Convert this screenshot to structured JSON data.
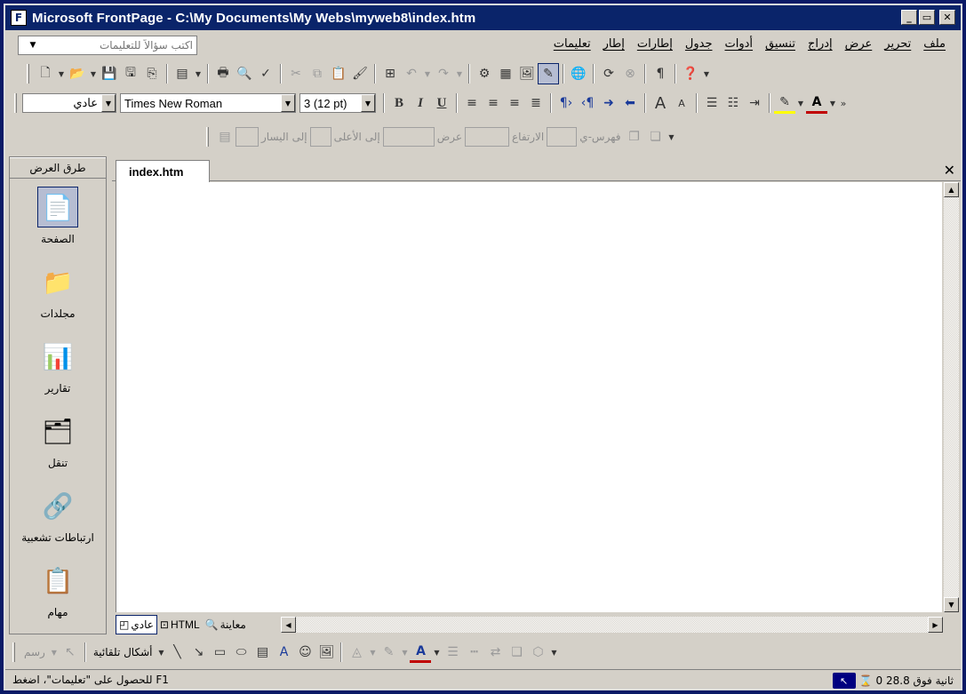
{
  "window": {
    "title": "Microsoft FrontPage - C:\\My Documents\\My Webs\\myweb8\\index.htm",
    "title_bg": "#0a246a",
    "controls": {
      "minimize": "_",
      "maximize": "▭",
      "close": "✕"
    }
  },
  "help_box": {
    "placeholder": "اكتب سؤالاً للتعليمات"
  },
  "menu": [
    "ملف",
    "تحرير",
    "عرض",
    "إدراج",
    "تنسيق",
    "أدوات",
    "جدول",
    "إطارات",
    "إطار",
    "تعليمات"
  ],
  "standard_toolbar": {
    "icons": [
      "new-page-icon",
      "open-icon",
      "save-icon",
      "publish-icon",
      "copy-page-icon",
      "folder-list-icon",
      "print-icon",
      "print-preview-icon",
      "spelling-icon",
      "cut-icon",
      "copy-icon",
      "paste-icon",
      "format-painter-icon",
      "insert-icon",
      "undo-icon",
      "redo-icon",
      "web-component-icon",
      "insert-table-icon",
      "insert-picture-icon",
      "drawing-icon",
      "hyperlink-icon",
      "refresh-icon",
      "stop-icon",
      "show-all-icon",
      "help-icon"
    ]
  },
  "format_toolbar": {
    "style": "عادي",
    "font": "Times New Roman",
    "size": "3  (12 pt)",
    "bold": "B",
    "italic": "I",
    "underline": "U"
  },
  "positioning_toolbar": {
    "z_order_label": "فهرس-ي",
    "height_label": "الارتفاع",
    "width_label": "عرض",
    "top_label": "إلى الأعلى",
    "left_label": "إلى اليسار"
  },
  "views_bar": {
    "heading": "طرق العرض",
    "items": [
      {
        "label": "الصفحة",
        "icon": "page-view-icon",
        "glyph": "📄"
      },
      {
        "label": "مجلدات",
        "icon": "folders-icon",
        "glyph": "📁"
      },
      {
        "label": "تقارير",
        "icon": "reports-icon",
        "glyph": "📊"
      },
      {
        "label": "تنقل",
        "icon": "navigation-icon",
        "glyph": "🗂"
      },
      {
        "label": "ارتباطات تشعبية",
        "icon": "hyperlinks-icon",
        "glyph": "🔗"
      },
      {
        "label": "مهام",
        "icon": "tasks-icon",
        "glyph": "📋"
      }
    ]
  },
  "document": {
    "tab": "index.htm",
    "close": "✕",
    "view_tabs": [
      {
        "label": "عادي",
        "glyph": "◰"
      },
      {
        "label": "HTML",
        "glyph": "⊡"
      },
      {
        "label": "معاينة",
        "glyph": "🔍"
      }
    ]
  },
  "drawing_toolbar": {
    "draw_label": "رسم",
    "autoshapes_label": "أشكال تلقائية"
  },
  "status": {
    "help_text": "F1 للحصول على \"تعليمات\"، اضغط",
    "connection": "ثانية فوق 28.8 0",
    "hourglass": "⌛"
  }
}
